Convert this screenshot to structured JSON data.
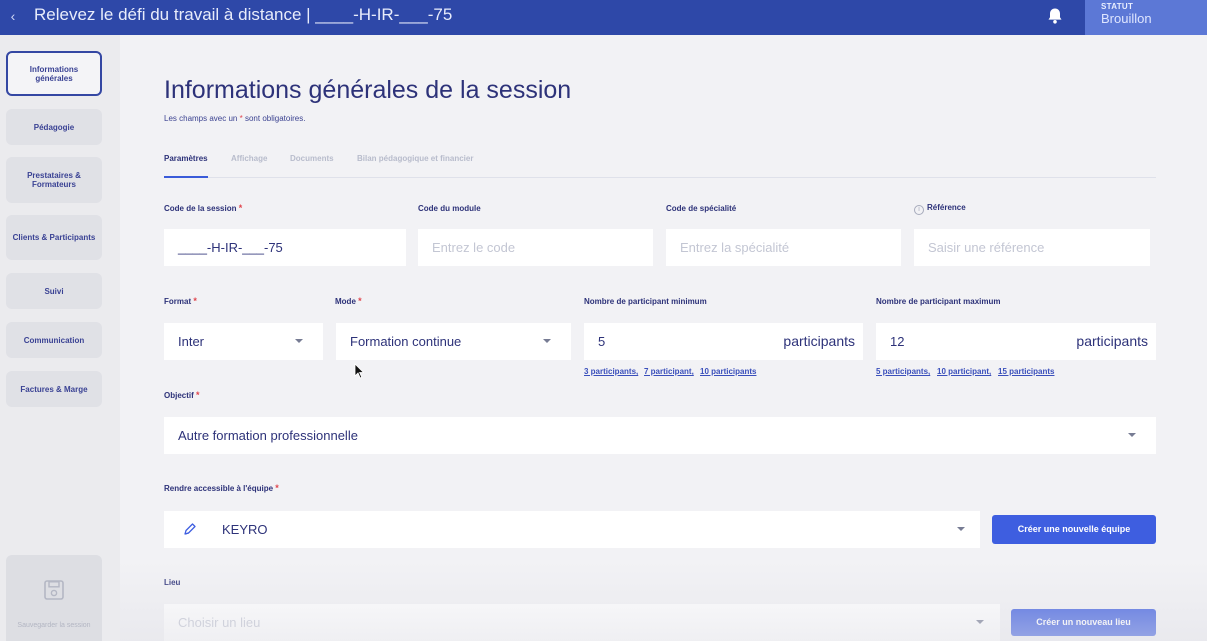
{
  "topbar": {
    "back_label": "‹",
    "title": "Relevez le défi du travail à distance | ____-H-IR-___-75",
    "status_label": "STATUT",
    "status_value": "Brouillon"
  },
  "sidebar": {
    "items": [
      {
        "label": "Informations générales",
        "active": true
      },
      {
        "label": "Pédagogie"
      },
      {
        "label": "Prestataires & Formateurs"
      },
      {
        "label": "Clients & Participants"
      },
      {
        "label": "Suivi"
      },
      {
        "label": "Communication"
      },
      {
        "label": "Factures & Marge"
      }
    ],
    "save_label": "Sauvegarder la session"
  },
  "page": {
    "title": "Informations générales de la session",
    "required_note_before": "Les champs avec un",
    "required_star": "*",
    "required_note_after": "sont obligatoires."
  },
  "tabs": [
    {
      "label": "Paramètres",
      "active": true
    },
    {
      "label": "Affichage"
    },
    {
      "label": "Documents"
    },
    {
      "label": "Bilan pédagogique et financier"
    }
  ],
  "form": {
    "code_session": {
      "label": "Code de la session",
      "value": "____-H-IR-___-75"
    },
    "code_module": {
      "label": "Code du module",
      "placeholder": "Entrez le code"
    },
    "code_specialite": {
      "label": "Code de spécialité",
      "placeholder": "Entrez la spécialité"
    },
    "reference": {
      "label": "Référence",
      "placeholder": "Saisir une référence",
      "info_icon": "i"
    },
    "format": {
      "label": "Format",
      "value": "Inter"
    },
    "mode": {
      "label": "Mode",
      "value": "Formation continue"
    },
    "participants_min": {
      "label": "Nombre de participant minimum",
      "value": "5",
      "suffix": "participants",
      "quick": [
        "3 participants,",
        "7 participant,",
        "10 participants"
      ]
    },
    "participants_max": {
      "label": "Nombre de participant maximum",
      "value": "12",
      "suffix": "participants",
      "quick": [
        "5 participants,",
        "10 participant,",
        "15 participants"
      ]
    },
    "objectif": {
      "label": "Objectif",
      "value": "Autre formation professionnelle"
    },
    "equipe": {
      "label": "Rendre accessible à l'équipe",
      "value": "KEYRO",
      "button": "Créer une nouvelle équipe"
    },
    "lieu": {
      "label": "Lieu",
      "placeholder": "Choisir un lieu",
      "button": "Créer un nouveau lieu"
    },
    "required_star": "*"
  },
  "icons": {
    "back": "chevron-left-icon",
    "bell": "bell-icon",
    "save": "floppy-disk-icon",
    "pencil": "pencil-icon",
    "info": "info-icon",
    "caret": "caret-down-icon"
  },
  "colors": {
    "topbar": "#2e48a8",
    "status": "#5c78d6",
    "primary": "#3e5ee0",
    "required": "#e0464e",
    "text": "#2d3279"
  }
}
